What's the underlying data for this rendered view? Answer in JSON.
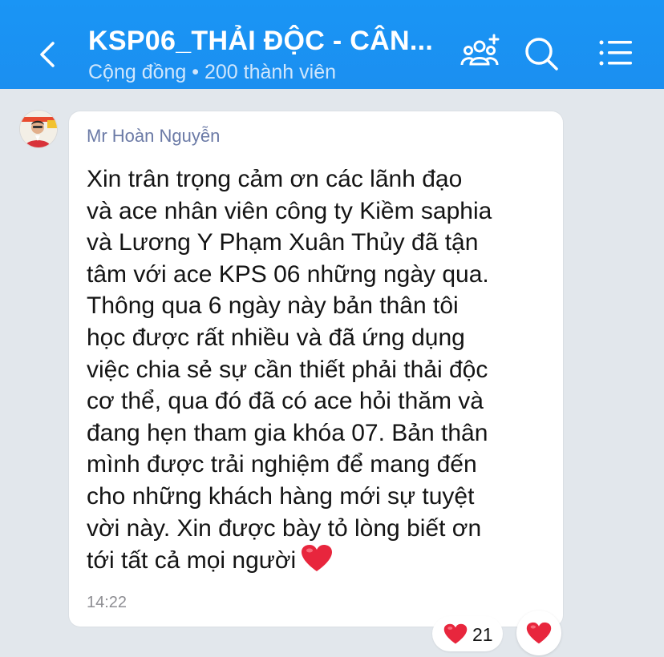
{
  "header": {
    "title": "KSP06_THẢI ĐỘC - CÂN...",
    "subtitle": "Cộng đồng • 200 thành viên",
    "icons": [
      "chevron-left-icon",
      "add-member-icon",
      "search-icon",
      "menu-list-icon"
    ]
  },
  "message": {
    "sender": "Mr Hoàn Nguyễn",
    "lines": [
      "Xin trân trọng cảm ơn các lãnh đạo",
      "và ace nhân viên công ty Kiềm saphia",
      "và Lương Y Phạm Xuân Thủy đã tận",
      "tâm với ace KPS 06 những ngày qua.",
      "Thông qua 6 ngày này bản thân tôi",
      "học được rất nhiều và đã ứng dụng",
      "việc chia sẻ sự cần thiết phải thải độc",
      "cơ thể, qua đó đã có ace hỏi thăm và",
      "đang hẹn tham gia khóa 07. Bản thân",
      "mình được trải nghiệm để mang đến",
      "cho những khách hàng mới sự tuyệt",
      "vời này. Xin được bày tỏ lòng biết ơn",
      "tới tất cả mọi người"
    ],
    "time": "14:22",
    "reaction_count": "21"
  },
  "colors": {
    "header_blue": "#1b8ff0",
    "heart_red": "#e8263d",
    "background": "#e2e7ec"
  }
}
